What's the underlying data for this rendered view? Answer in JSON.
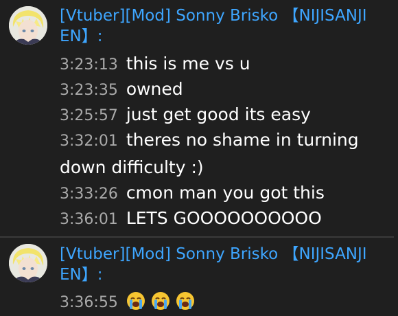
{
  "groups": [
    {
      "author": "[Vtuber][Mod] Sonny Brisko 【NIJISANJI EN】:",
      "messages": [
        {
          "time": "3:23:13",
          "text": "this is me vs u"
        },
        {
          "time": "3:23:35",
          "text": "owned"
        },
        {
          "time": "3:25:57",
          "text": "just get good its easy"
        },
        {
          "time": "3:32:01",
          "text": "theres no shame in turning down difficulty :)"
        },
        {
          "time": "3:33:26",
          "text": "cmon man you got this"
        },
        {
          "time": "3:36:01",
          "text": "LETS GOOOOOOOOOO"
        }
      ]
    },
    {
      "author": "[Vtuber][Mod] Sonny Brisko 【NIJISANJI EN】:",
      "messages": [
        {
          "time": "3:36:55",
          "emojis": [
            "loudly-crying-face",
            "loudly-crying-face",
            "loudly-crying-face"
          ]
        }
      ]
    }
  ]
}
